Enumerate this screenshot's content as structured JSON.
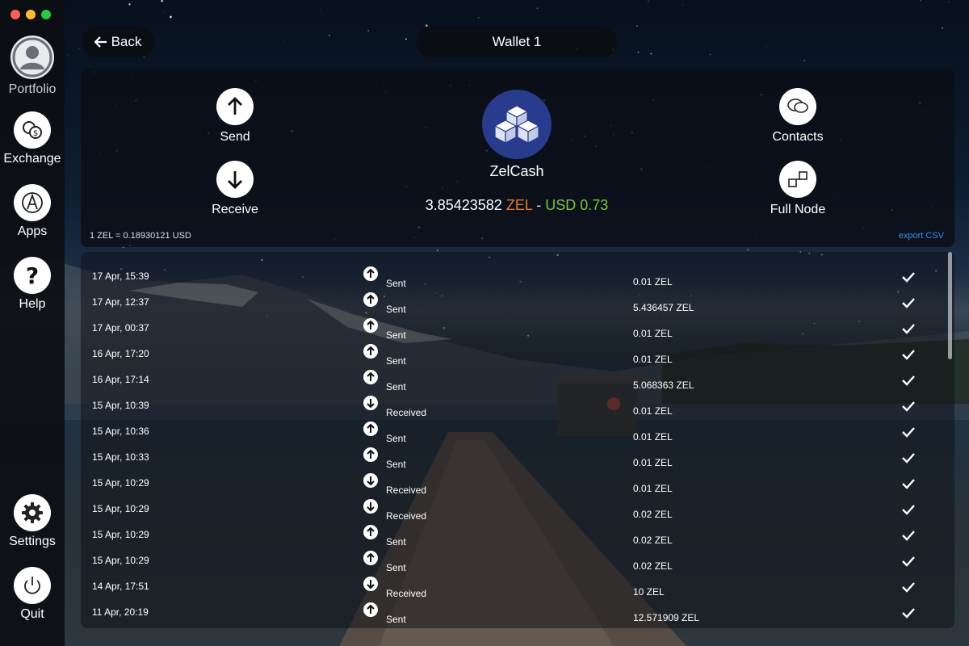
{
  "window": {
    "traffic_colors": [
      "#fe5f57",
      "#febc2e",
      "#28c840"
    ]
  },
  "sidebar": {
    "items": [
      {
        "label": "Portfolio",
        "icon": "user-avatar-icon"
      },
      {
        "label": "Exchange",
        "icon": "exchange-icon"
      },
      {
        "label": "Apps",
        "icon": "apps-icon"
      },
      {
        "label": "Help",
        "icon": "help-icon"
      },
      {
        "label": "Settings",
        "icon": "gear-icon"
      },
      {
        "label": "Quit",
        "icon": "power-icon"
      }
    ]
  },
  "header": {
    "back_label": "Back",
    "title": "Wallet 1"
  },
  "actions": {
    "send": "Send",
    "receive": "Receive",
    "contacts": "Contacts",
    "full_node": "Full Node"
  },
  "coin": {
    "name": "ZelCash",
    "balance": "3.85423582",
    "ticker": "ZEL",
    "separator": "-",
    "usd_value": "USD 0.73",
    "rate": "1 ZEL = 0.18930121 USD",
    "export_label": "export CSV",
    "colors": {
      "ticker": "#e8772e",
      "usd": "#7cc63a",
      "coin_bg": "#283b8c"
    }
  },
  "transactions": [
    {
      "date": "17 Apr, 15:39",
      "type": "Sent",
      "dir": "up",
      "amount": "0.01 ZEL"
    },
    {
      "date": "17 Apr, 12:37",
      "type": "Sent",
      "dir": "up",
      "amount": "5.436457 ZEL"
    },
    {
      "date": "17 Apr, 00:37",
      "type": "Sent",
      "dir": "up",
      "amount": "0.01 ZEL"
    },
    {
      "date": "16 Apr, 17:20",
      "type": "Sent",
      "dir": "up",
      "amount": "0.01 ZEL"
    },
    {
      "date": "16 Apr, 17:14",
      "type": "Sent",
      "dir": "up",
      "amount": "5.068363 ZEL"
    },
    {
      "date": "15 Apr, 10:39",
      "type": "Received",
      "dir": "down",
      "amount": "0.01 ZEL"
    },
    {
      "date": "15 Apr, 10:36",
      "type": "Sent",
      "dir": "up",
      "amount": "0.01 ZEL"
    },
    {
      "date": "15 Apr, 10:33",
      "type": "Sent",
      "dir": "up",
      "amount": "0.01 ZEL"
    },
    {
      "date": "15 Apr, 10:29",
      "type": "Received",
      "dir": "down",
      "amount": "0.01 ZEL"
    },
    {
      "date": "15 Apr, 10:29",
      "type": "Received",
      "dir": "down",
      "amount": "0.02 ZEL"
    },
    {
      "date": "15 Apr, 10:29",
      "type": "Sent",
      "dir": "up",
      "amount": "0.02 ZEL"
    },
    {
      "date": "15 Apr, 10:29",
      "type": "Sent",
      "dir": "up",
      "amount": "0.02 ZEL"
    },
    {
      "date": "14 Apr, 17:51",
      "type": "Received",
      "dir": "down",
      "amount": "10 ZEL"
    },
    {
      "date": "11 Apr, 20:19",
      "type": "Sent",
      "dir": "up",
      "amount": "12.571909 ZEL"
    }
  ]
}
